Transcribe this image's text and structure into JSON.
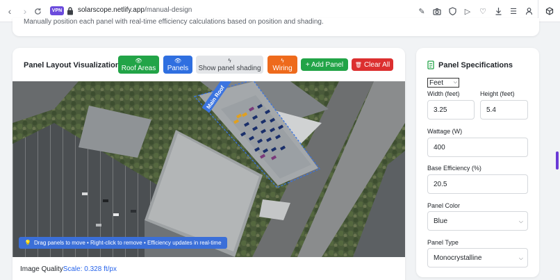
{
  "browser": {
    "vpn_label": "VPN",
    "url_host": "solarscope.netlify.app",
    "url_path": "/manual-design"
  },
  "intro": {
    "text": "Manually position each panel with real-time efficiency calculations based on position and shading."
  },
  "layout_panel": {
    "title": "Panel Layout Visualization",
    "buttons": {
      "roof_areas": "Roof Areas",
      "panels": "Panels",
      "shading": "Show panel shading",
      "wiring": "Wiring",
      "add_panel": "+ Add Panel",
      "clear_all": "Clear All"
    },
    "roof_label": "Main Roof",
    "hint": "Drag panels to move • Right-click to remove • Efficiency updates in real-time",
    "quality_label": "Image Quality",
    "scale_label": "Scale: 0.328 ft/px"
  },
  "specs": {
    "title": "Panel Specifications",
    "unit": "Feet",
    "width_label": "Width (feet)",
    "width_value": "3.25",
    "height_label": "Height (feet)",
    "height_value": "5.4",
    "wattage_label": "Wattage (W)",
    "wattage_value": "400",
    "efficiency_label": "Base Efficiency (%)",
    "efficiency_value": "20.5",
    "color_label": "Panel Color",
    "color_value": "Blue",
    "type_label": "Panel Type",
    "type_value": "Monocrystalline"
  },
  "colors": {
    "green": "#22a447",
    "blue": "#2f6fe0",
    "gray": "#e4e6e9",
    "orange": "#ee6a1c",
    "red": "#dc2f2f",
    "scale_blue": "#2563eb"
  }
}
